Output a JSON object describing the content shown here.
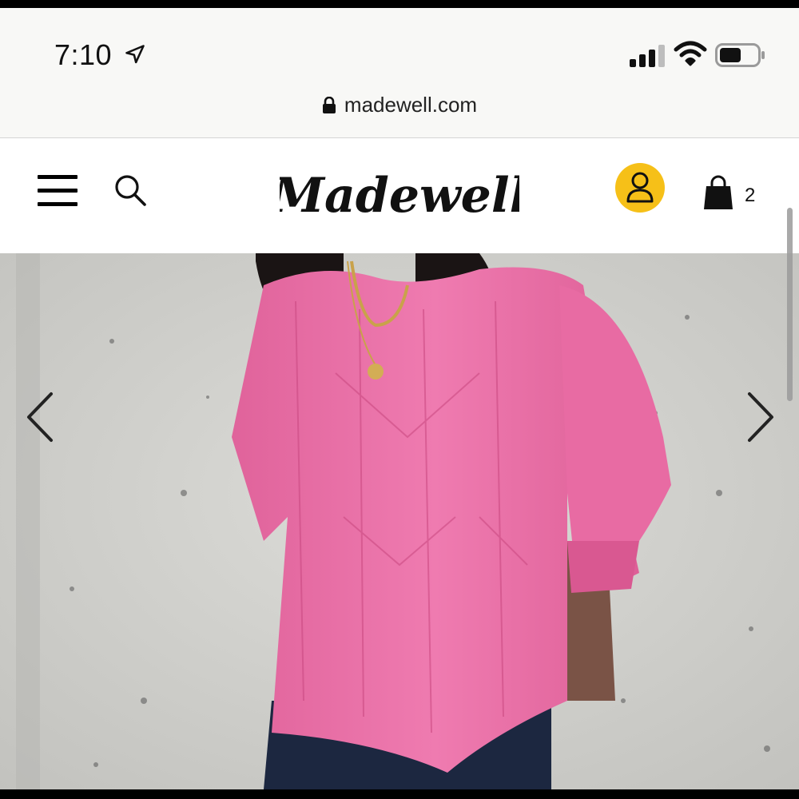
{
  "status_bar": {
    "time": "7:10",
    "location_icon": "location-arrow-icon",
    "signal_icon": "cellular-signal-icon",
    "wifi_icon": "wifi-icon",
    "battery_icon": "battery-icon",
    "battery_level": 0.5
  },
  "browser": {
    "url": "madewell.com",
    "lock_icon": "lock-icon"
  },
  "header": {
    "brand": "Madewell",
    "menu_icon": "hamburger-menu-icon",
    "search_icon": "search-icon",
    "account_icon": "user-icon",
    "account_color": "#f6c018",
    "bag_icon": "shopping-bag-icon",
    "bag_count": "2"
  },
  "hero": {
    "prev_icon": "chevron-left-icon",
    "next_icon": "chevron-right-icon",
    "sweater_color": "#ec73a8"
  }
}
